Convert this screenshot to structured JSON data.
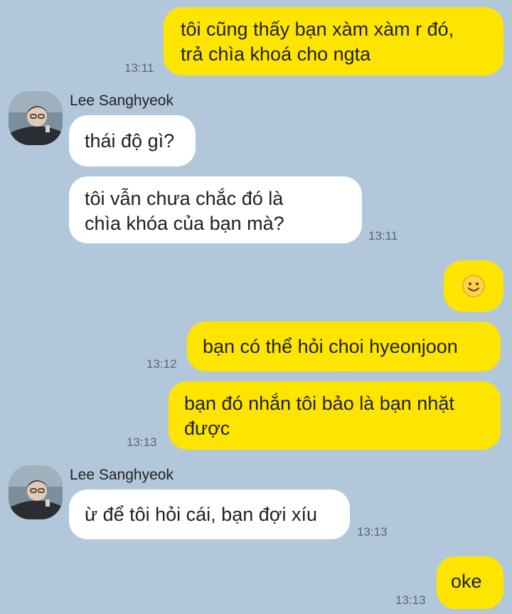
{
  "messages": [
    {
      "sender": "me",
      "text_lines": [
        "tôi cũng thấy bạn xàm xàm r đó,",
        "trả chìa khoá cho ngta"
      ],
      "time": "13:11"
    },
    {
      "sender": "Lee Sanghyeok",
      "text": "thái độ gì?"
    },
    {
      "sender": "Lee Sanghyeok",
      "text_lines": [
        "tôi vẫn chưa chắc đó là",
        "chìa khóa của bạn mà?"
      ],
      "time": "13:11"
    },
    {
      "sender": "me",
      "emoji": "🙂"
    },
    {
      "sender": "me",
      "text": "bạn có thể hỏi choi hyeonjoon",
      "time": "13:12"
    },
    {
      "sender": "me",
      "text_lines": [
        "bạn đó nhắn tôi bảo là bạn nhặt",
        "được"
      ],
      "time": "13:13"
    },
    {
      "sender": "Lee Sanghyeok",
      "text": "ừ để tôi hỏi cái, bạn đợi xíu",
      "time": "13:13"
    },
    {
      "sender": "me",
      "text": "oke",
      "time": "13:13"
    }
  ],
  "contact": {
    "name": "Lee Sanghyeok"
  },
  "colors": {
    "background": "#b2c7da",
    "outgoing": "#fee500",
    "incoming": "#ffffff"
  }
}
